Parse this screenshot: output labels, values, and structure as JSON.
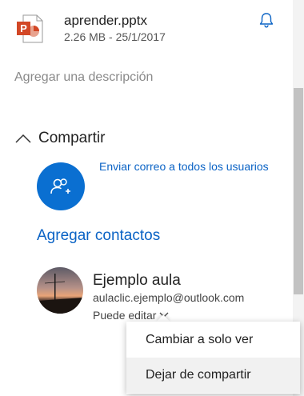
{
  "header": {
    "file_name": "aprender.pptx",
    "file_meta": "2.26 MB - 25/1/2017",
    "file_icon": "powerpoint-file-icon",
    "bell_icon": "bell-icon"
  },
  "description_placeholder": "Agregar una descripción",
  "share": {
    "title": "Compartir",
    "email_all": "Enviar correo a todos los usuarios",
    "add_contacts": "Agregar contactos"
  },
  "contact": {
    "name": "Ejemplo aula",
    "email": "aulaclic.ejemplo@outlook.com",
    "permission": "Puede editar"
  },
  "menu": {
    "items": [
      "Cambiar a solo ver",
      "Dejar de compartir"
    ]
  },
  "colors": {
    "accent": "#0a6fd1",
    "link": "#0b63c5",
    "powerpoint": "#d24726"
  }
}
